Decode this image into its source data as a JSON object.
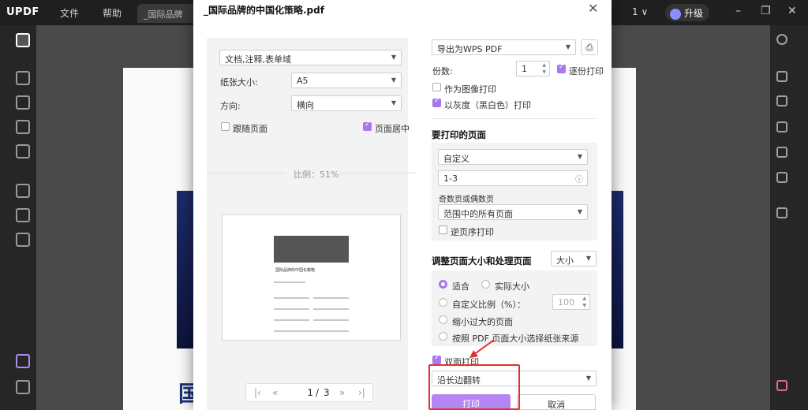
{
  "app": {
    "logo_text": "UPDF",
    "menus": [
      "文件",
      "帮助"
    ],
    "tab_title": "_国际品牌",
    "page_counter": "1 ∨",
    "upgrade_label": "升级",
    "accent_color": "#a677ee",
    "document_heading_fragment": "国"
  },
  "dialog": {
    "title": "_国际品牌的中国化策略.pdf",
    "close_icon": "close-icon",
    "left": {
      "content_select": "文档,注释,表单域",
      "paper_size_label": "纸张大小:",
      "paper_size_value": "A5",
      "orientation_label": "方向:",
      "orientation_value": "横向",
      "follow_page_label": "跟随页面",
      "follow_page_checked": false,
      "center_page_label": "页面居中",
      "center_page_checked": true,
      "scale_label": "比例：51%",
      "preview_title": "国际品牌的中国化策略",
      "pager": {
        "first": "|‹",
        "prev": "«",
        "current": "1",
        "separator": "/",
        "total": "3",
        "next": "»",
        "last": "›|"
      }
    },
    "right": {
      "printer_select": "导出为WPS PDF",
      "copies_label": "份数:",
      "copies_value": "1",
      "collate_label": "逐份打印",
      "collate_checked": true,
      "as_image_label": "作为图像打印",
      "as_image_checked": false,
      "grayscale_label": "以灰度（黑白色）打印",
      "grayscale_checked": true,
      "pages_section_title": "要打印的页面",
      "pages_mode_select": "自定义",
      "pages_range_value": "1-3",
      "odd_even_label": "奇数页或偶数页",
      "odd_even_select": "范围中的所有页面",
      "reverse_label": "逆页序打印",
      "reverse_checked": false,
      "size_section_title": "调整页面大小和处理页面",
      "size_mode_select": "大小",
      "fit_label": "适合",
      "actual_size_label": "实际大小",
      "custom_scale_label": "自定义比例（%）：",
      "custom_scale_value": "100",
      "shrink_label": "缩小过大的页面",
      "choose_source_label": "按照 PDF 页面大小选择纸张来源",
      "selected_size_option": "适合",
      "duplex_label": "双面打印",
      "duplex_checked": true,
      "flip_select": "沿长边翻转",
      "print_button": "打印",
      "cancel_button": "取消"
    }
  }
}
